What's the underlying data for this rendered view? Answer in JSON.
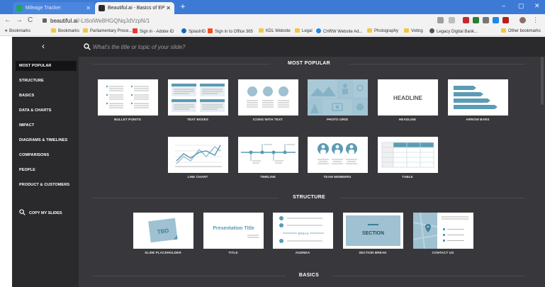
{
  "browser": {
    "tabs": [
      {
        "title": "Mileage Tracker"
      },
      {
        "title": "Beautiful.ai - Basics of EP"
      }
    ],
    "url_host": "beautiful.ai",
    "url_path": "/-Lt6oiWe8HGQNqJdVzpN/1",
    "bookmarks_label": "Bookmarks",
    "bookmarks": [
      "Bookmarks",
      "Parliamentary Proce...",
      "Sign in - Adobe ID",
      "SplashID",
      "Sign in to Office 365",
      "KDL Website",
      "Legal",
      "CHRW Website Ad...",
      "Photography",
      "Voting",
      "Legacy Digital Bank...",
      "Other bookmarks"
    ]
  },
  "search": {
    "placeholder": "What's the title or topic of your slide?"
  },
  "categories": [
    "MOST POPULAR",
    "STRUCTURE",
    "BASICS",
    "DATA & CHARTS",
    "IMPACT",
    "DIAGRAMS & TIMELINES",
    "COMPARISONS",
    "PEOPLE",
    "PRODUCT & CUSTOMERS"
  ],
  "copy_my_slides": "COPY MY SLIDES",
  "sections": {
    "most_popular": "MOST POPULAR",
    "structure": "STRUCTURE",
    "basics": "BASICS"
  },
  "most_popular_cards": [
    "BULLET POINTS",
    "TEXT BOXES",
    "ICONS WITH TEXT",
    "PHOTO GRID",
    "HEADLINE",
    "ARROW BARS",
    "LINE CHART",
    "TIMELINE",
    "TEAM MEMBERS",
    "TABLE"
  ],
  "structure_cards": [
    "SLIDE PLACEHOLDER",
    "TITLE",
    "AGENDA",
    "SECTION BREAK",
    "CONTACT US"
  ],
  "thumb_text": {
    "headline": "HEADLINE",
    "tbd": "TBD",
    "presentation_title": "Presentation Title",
    "break": "BREAK",
    "section": "SECTION"
  },
  "colors": {
    "accent": "#5b9bb3",
    "accent_dark": "#3b7e98",
    "panel": "#2a2a2d",
    "content_bg": "#38383c",
    "tab_bar": "#3d7ad6"
  }
}
